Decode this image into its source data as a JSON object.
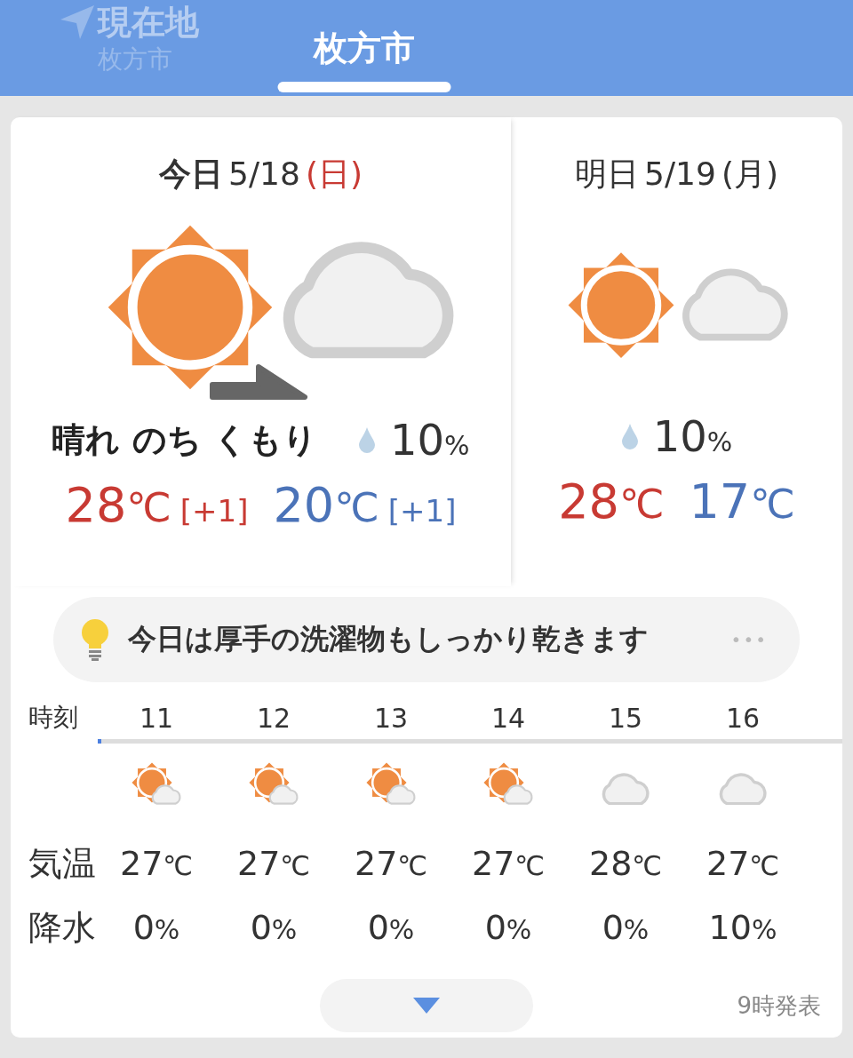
{
  "header": {
    "tabs": [
      {
        "label": "現在地",
        "sublabel": "枚方市",
        "kind": "location",
        "selected": false
      },
      {
        "label": "枚方市",
        "selected": true,
        "kind": "city"
      }
    ]
  },
  "days": [
    {
      "label": "今日",
      "date": "5/18",
      "weekday": "(日)",
      "sunday": true,
      "selected": true,
      "kind": "sun_then_cloud",
      "weather": "晴れ のち くもり",
      "rain": "10",
      "rain_unit": "%",
      "high": "28",
      "high_diff": "[+1]",
      "low": "20",
      "low_diff": "[+1]",
      "unit": "℃"
    },
    {
      "label": "明日",
      "date": "5/19",
      "weekday": "(月)",
      "sunday": false,
      "selected": false,
      "kind": "sun_cloud",
      "rain": "10",
      "rain_unit": "%",
      "high": "28",
      "low": "17",
      "unit": "℃"
    }
  ],
  "advice": {
    "text": "今日は厚手の洗濯物もしっかり乾きます",
    "more": "•••"
  },
  "hourly": {
    "labels": [
      "時刻",
      "気温",
      "降水"
    ],
    "hours": [
      {
        "hour": "11",
        "kind": "sun_cloud",
        "temp": "27",
        "rain": "0"
      },
      {
        "hour": "12",
        "kind": "sun_cloud",
        "temp": "27",
        "rain": "0"
      },
      {
        "hour": "13",
        "kind": "sun_cloud",
        "temp": "27",
        "rain": "0"
      },
      {
        "hour": "14",
        "kind": "sun_cloud",
        "temp": "27",
        "rain": "0"
      },
      {
        "hour": "15",
        "kind": "cloud",
        "temp": "28",
        "rain": "0"
      },
      {
        "hour": "16",
        "kind": "cloud",
        "temp": "27",
        "rain": "10"
      }
    ],
    "temp_unit": "℃",
    "rain_unit": "%"
  },
  "footer": {
    "issued": "9時発表"
  }
}
